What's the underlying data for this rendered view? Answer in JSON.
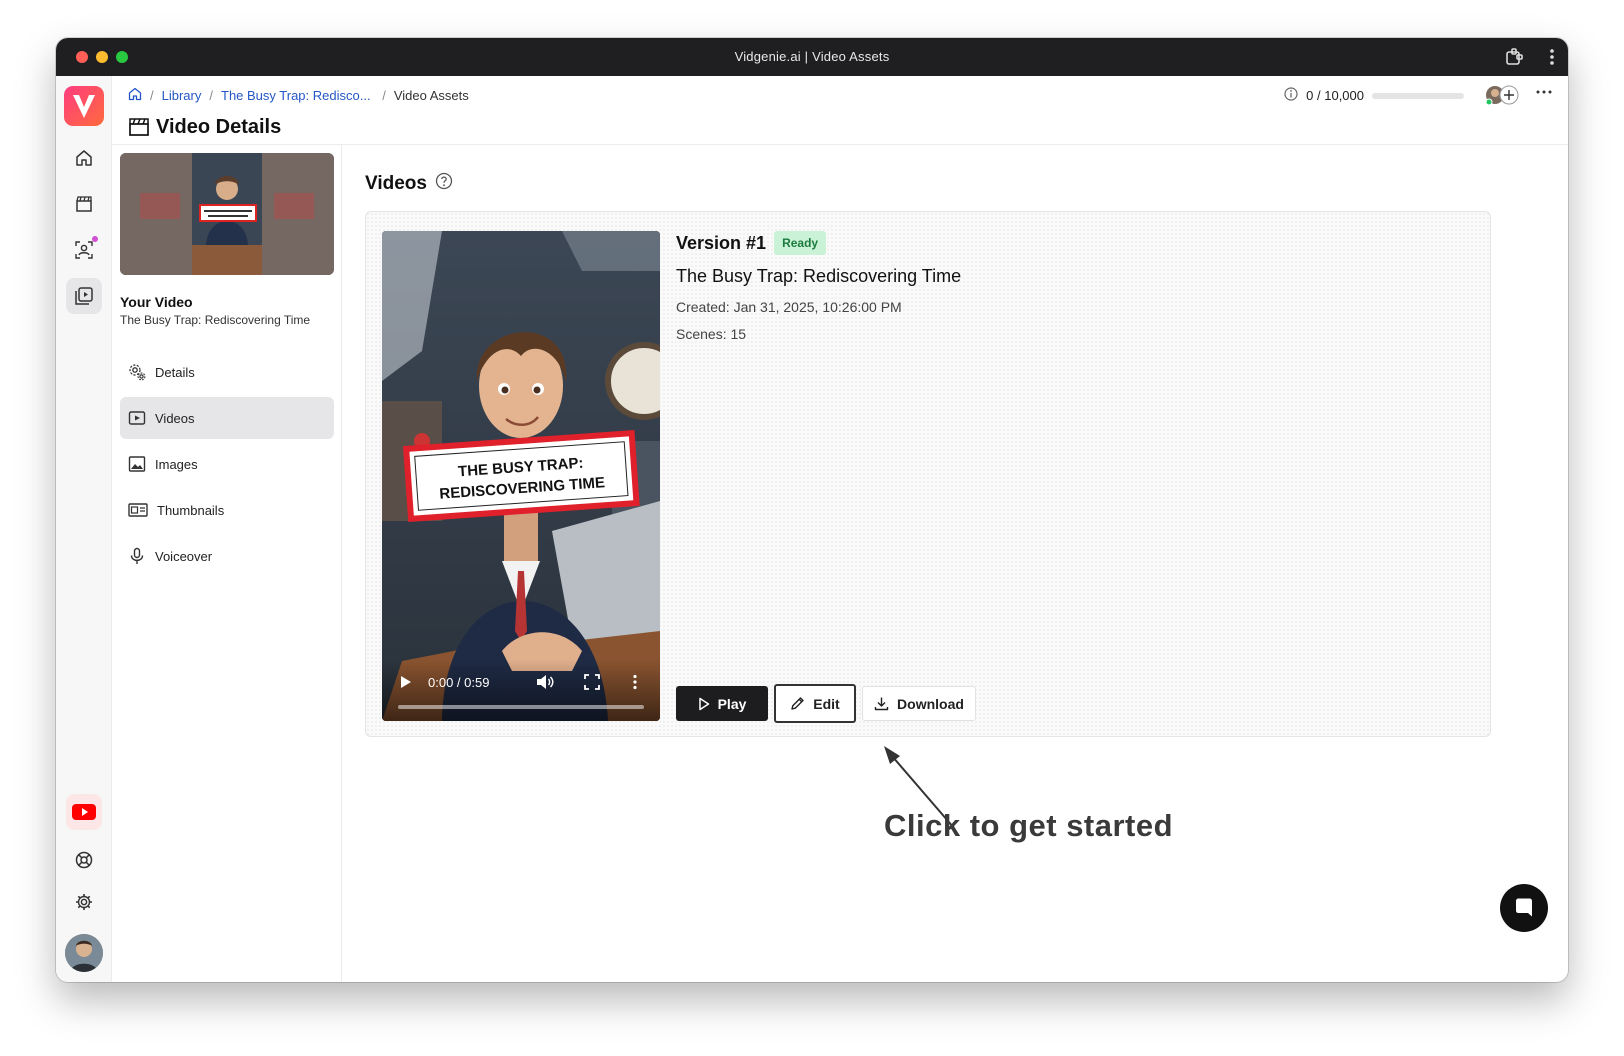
{
  "window": {
    "title": "Vidgenie.ai | Video Assets"
  },
  "breadcrumb": {
    "items": [
      "Library",
      "The Busy Trap: Redisco...",
      "Video Assets"
    ]
  },
  "credits": {
    "label": "0 / 10,000",
    "used_fraction": 0.0
  },
  "page": {
    "title": "Video Details"
  },
  "sidebar": {
    "your_video_label": "Your Video",
    "video_name": "The Busy Trap: Rediscovering Time",
    "thumbnail_text": "THE BUSY TRAP: REDISCOVERING TIME",
    "nav": [
      {
        "label": "Details",
        "icon": "gear-icon"
      },
      {
        "label": "Videos",
        "icon": "play-square-icon",
        "active": true
      },
      {
        "label": "Images",
        "icon": "image-icon"
      },
      {
        "label": "Thumbnails",
        "icon": "thumbnails-icon"
      },
      {
        "label": "Voiceover",
        "icon": "microphone-icon"
      }
    ]
  },
  "main": {
    "section_title": "Videos",
    "version": {
      "label": "Version #1",
      "status": "Ready",
      "title": "The Busy Trap: Rediscovering Time",
      "created": "Created: Jan 31, 2025, 10:26:00 PM",
      "scenes": "Scenes: 15"
    },
    "player": {
      "overlay_line1": "THE BUSY TRAP:",
      "overlay_line2": "REDISCOVERING TIME",
      "time": "0:00 / 0:59",
      "progress_fraction": 0.0
    },
    "buttons": {
      "play": "Play",
      "edit": "Edit",
      "download": "Download"
    }
  },
  "annotation": {
    "hint": "Click to get started"
  },
  "colors": {
    "accent": "#2457c5",
    "ready_bg": "#c9f2d6",
    "ready_fg": "#1d7a3e",
    "dark_button": "#1d1d1f",
    "logo_gradient": "#ff3d7f"
  }
}
